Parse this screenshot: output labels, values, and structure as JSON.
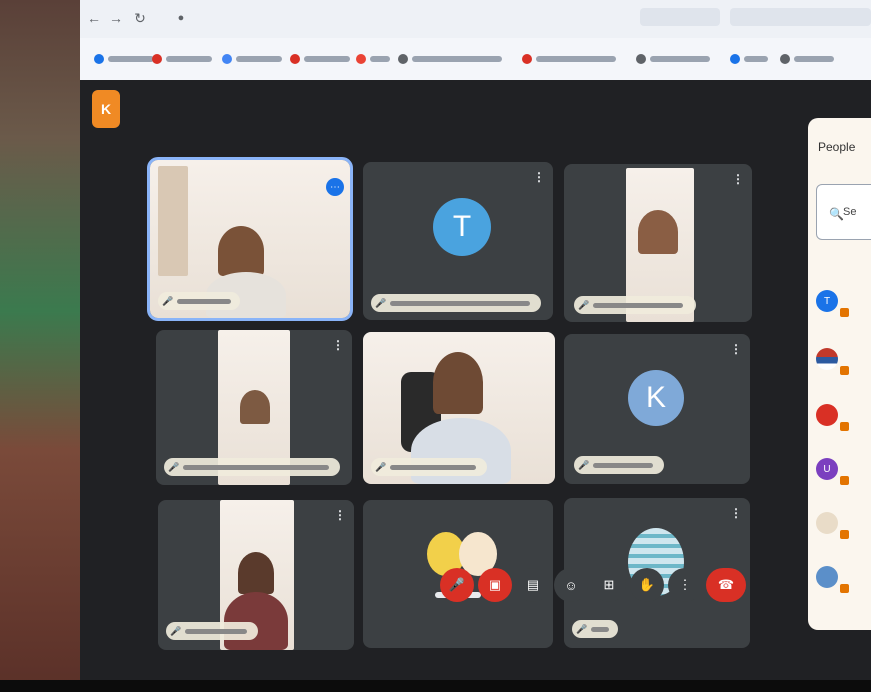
{
  "browser": {
    "address": "",
    "bookmarks": [
      {
        "label": "",
        "color": "#1a73e8"
      },
      {
        "label": "",
        "color": "#d93025"
      },
      {
        "label": "",
        "color": "#4285f4"
      },
      {
        "label": "",
        "color": "#d93025"
      },
      {
        "label": "",
        "color": "#ea4335"
      },
      {
        "label": "",
        "color": "#5f6368"
      },
      {
        "label": "",
        "color": "#d93025"
      },
      {
        "label": "",
        "color": "#5f6368"
      },
      {
        "label": "",
        "color": "#1a73e8"
      },
      {
        "label": "",
        "color": "#5f6368"
      }
    ]
  },
  "meeting": {
    "app_logo": "K",
    "tiles": [
      {
        "id": "tile-1",
        "kind": "video",
        "name": ""
      },
      {
        "id": "tile-2",
        "kind": "avatar",
        "initial": "T",
        "avatar_color": "#4aa3df",
        "name": ""
      },
      {
        "id": "tile-3",
        "kind": "video",
        "name": ""
      },
      {
        "id": "tile-4",
        "kind": "video",
        "name": ""
      },
      {
        "id": "tile-5",
        "kind": "video",
        "name": ""
      },
      {
        "id": "tile-6",
        "kind": "avatar",
        "initial": "K",
        "avatar_color": "#7fa9d8",
        "name": ""
      },
      {
        "id": "tile-7",
        "kind": "video",
        "name": ""
      },
      {
        "id": "tile-8",
        "kind": "group",
        "caption": ""
      },
      {
        "id": "tile-9",
        "kind": "avatar-image",
        "name": ""
      }
    ]
  },
  "people_panel": {
    "title": "People",
    "search_text": "Se",
    "count_text": "",
    "people": [
      {
        "initial": "T",
        "color": "#1a73e8"
      },
      {
        "initial": "",
        "color": "#c0392b"
      },
      {
        "initial": "",
        "color": "#d93025"
      },
      {
        "initial": "U",
        "color": "#7b3fbf"
      },
      {
        "initial": "",
        "color": "#e9dcc8"
      },
      {
        "initial": "",
        "color": "#5b8fc9"
      }
    ]
  },
  "controls": {
    "buttons": [
      {
        "name": "mic-button",
        "icon": "microphone",
        "color": "#d93025"
      },
      {
        "name": "camera-button",
        "icon": "camera",
        "color": "#d93025"
      },
      {
        "name": "captions-button",
        "icon": "captions",
        "color": "#3c4043"
      },
      {
        "name": "emoji-button",
        "icon": "emoji",
        "color": "#3c4043"
      },
      {
        "name": "present-button",
        "icon": "present",
        "color": "#3c4043"
      },
      {
        "name": "raise-hand-button",
        "icon": "hand",
        "color": "#3c4043"
      },
      {
        "name": "more-options-button",
        "icon": "more-vertical",
        "color": "#3c4043"
      },
      {
        "name": "leave-call-button",
        "icon": "phone-hangup",
        "color": "#d93025"
      }
    ]
  }
}
